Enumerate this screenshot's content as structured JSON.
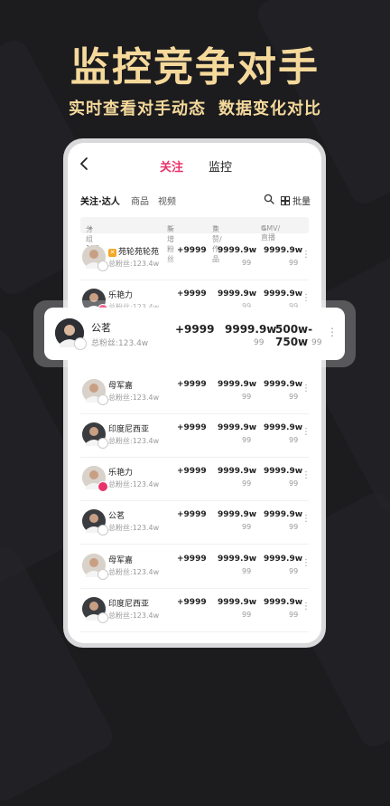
{
  "hero": {
    "title": "监控竞争对手",
    "sub1": "实时查看对手动态",
    "sub2": "数据变化对比",
    "color": "#f5d99b"
  },
  "nav": {
    "tabs": [
      {
        "label": "关注",
        "active": true
      },
      {
        "label": "监控",
        "active": false
      }
    ],
    "accent": "#e8336b"
  },
  "subtabs": {
    "items": [
      "关注·达人",
      "商品",
      "视频"
    ],
    "batch_label": "批量"
  },
  "columns": {
    "group": "分组123",
    "new_fans": "新增粉丝",
    "likes": "点赞/作品",
    "gmv": "GMV/直播"
  },
  "rows": [
    {
      "name": "苑轮苑轮苑",
      "fans": "总粉丝:123.4w",
      "new_fans": "+9999",
      "likes": "9999.9w",
      "likes_sub": "99",
      "gmv": "9999.9w",
      "gmv_sub": "99",
      "badge": "grey",
      "flag": true
    },
    {
      "name": "乐艳力",
      "fans": "总粉丝:123.4w",
      "new_fans": "+9999",
      "likes": "9999.9w",
      "likes_sub": "99",
      "gmv": "9999.9w",
      "gmv_sub": "99",
      "badge": "pink",
      "flag": false
    },
    {
      "name": "母军嘉",
      "fans": "总粉丝:123.4w",
      "new_fans": "+9999",
      "likes": "9999.9w",
      "likes_sub": "99",
      "gmv": "9999.9w",
      "gmv_sub": "99",
      "badge": "grey",
      "flag": false
    },
    {
      "name": "印度尼西亚",
      "fans": "总粉丝:123.4w",
      "new_fans": "+9999",
      "likes": "9999.9w",
      "likes_sub": "99",
      "gmv": "9999.9w",
      "gmv_sub": "99",
      "badge": "grey",
      "flag": false
    },
    {
      "name": "乐艳力",
      "fans": "总粉丝:123.4w",
      "new_fans": "+9999",
      "likes": "9999.9w",
      "likes_sub": "99",
      "gmv": "9999.9w",
      "gmv_sub": "99",
      "badge": "pink",
      "flag": false
    },
    {
      "name": "公茗",
      "fans": "总粉丝:123.4w",
      "new_fans": "+9999",
      "likes": "9999.9w",
      "likes_sub": "99",
      "gmv": "9999.9w",
      "gmv_sub": "99",
      "badge": "grey",
      "flag": false
    },
    {
      "name": "母军嘉",
      "fans": "总粉丝:123.4w",
      "new_fans": "+9999",
      "likes": "9999.9w",
      "likes_sub": "99",
      "gmv": "9999.9w",
      "gmv_sub": "99",
      "badge": "grey",
      "flag": false
    },
    {
      "name": "印度尼西亚",
      "fans": "总粉丝:123.4w",
      "new_fans": "+9999",
      "likes": "9999.9w",
      "likes_sub": "99",
      "gmv": "9999.9w",
      "gmv_sub": "99",
      "badge": "grey",
      "flag": false
    }
  ],
  "highlight": {
    "name": "公茗",
    "fans": "总粉丝:123.4w",
    "new_fans": "+9999",
    "likes": "9999.9w",
    "likes_sub": "99",
    "gmv": "500w-750w",
    "gmv_sub": "99"
  }
}
